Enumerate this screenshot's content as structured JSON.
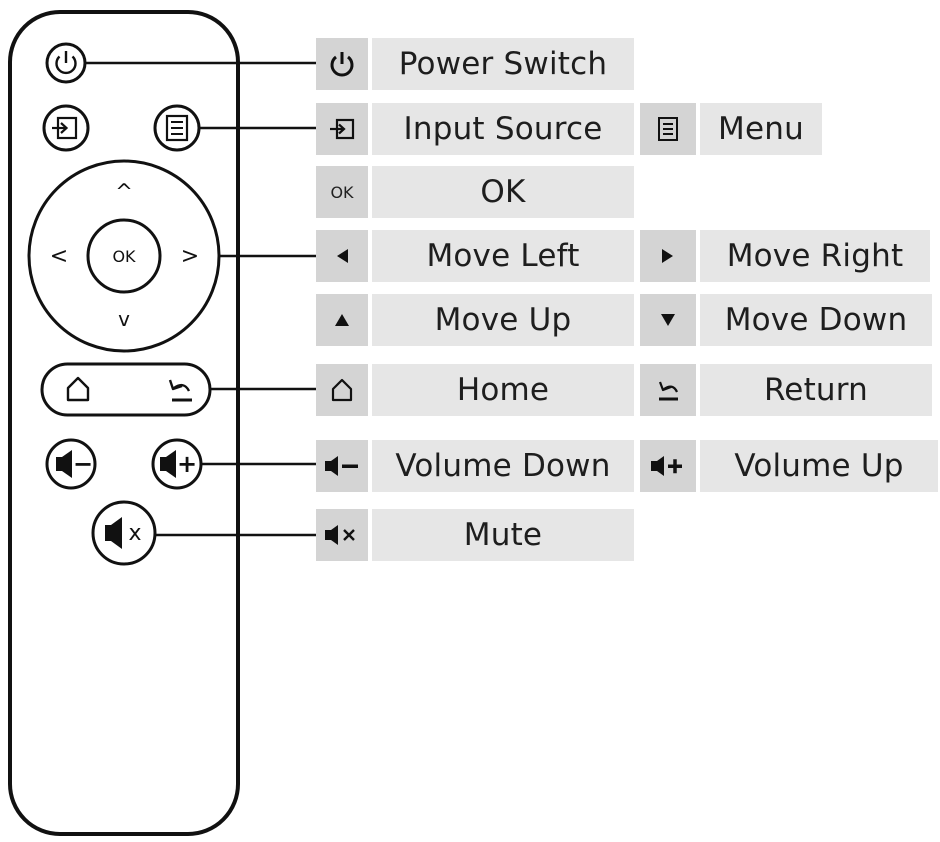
{
  "remote": {
    "ok_label": "OK",
    "dpad": {
      "up": "^",
      "down": "v",
      "left": "<",
      "right": ">"
    },
    "volume_down_sign": "−",
    "volume_up_sign": "+",
    "mute_sign": "x"
  },
  "legend": {
    "ok_icon_text": "OK",
    "power_switch": "Power Switch",
    "input_source": "Input Source",
    "menu": "Menu",
    "ok": "OK",
    "move_left": "Move Left",
    "move_right": "Move Right",
    "move_up": "Move Up",
    "move_down": "Move Down",
    "home": "Home",
    "return": "Return",
    "volume_down": "Volume Down",
    "volume_up": "Volume Up",
    "mute": "Mute"
  },
  "icons": [
    "power-icon",
    "input-source-icon",
    "menu-icon",
    "left-triangle-icon",
    "right-triangle-icon",
    "up-triangle-icon",
    "down-triangle-icon",
    "home-icon",
    "return-icon",
    "volume-down-icon",
    "volume-up-icon",
    "mute-icon"
  ],
  "colors": {
    "cell_bg": "#e6e6e6",
    "icon_cell_bg": "#d4d4d4",
    "outline": "#111111"
  }
}
